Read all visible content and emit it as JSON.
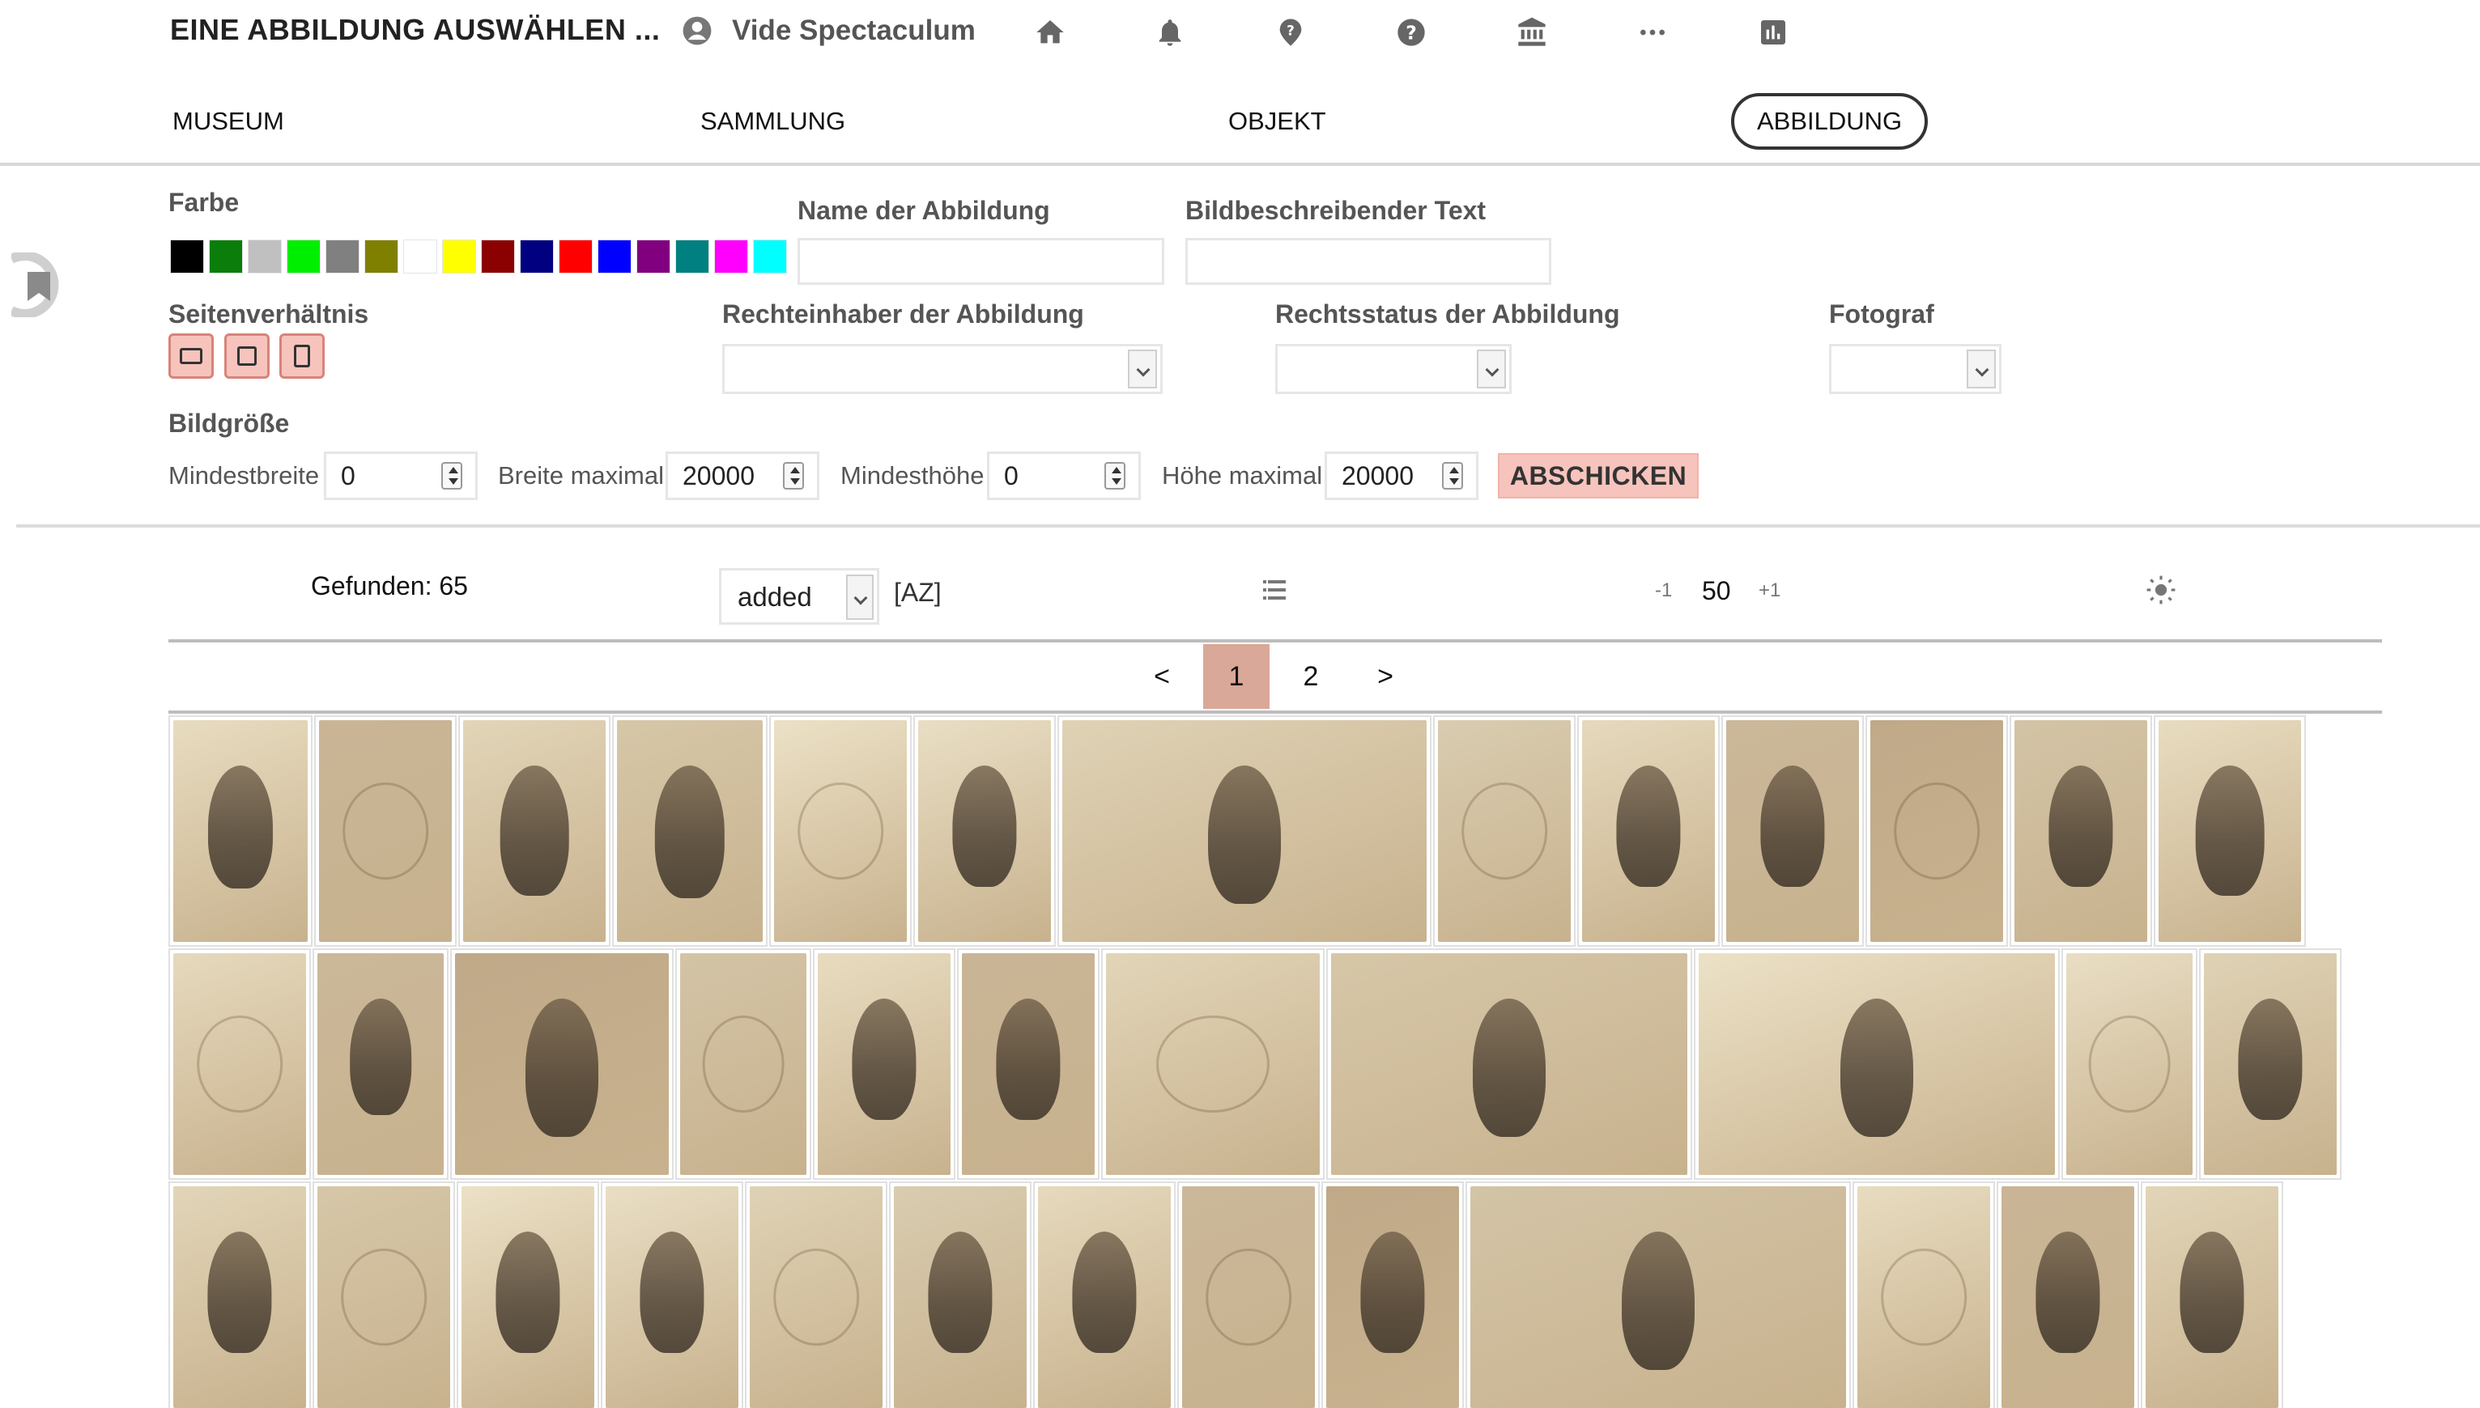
{
  "header": {
    "title": "EINE ABBILDUNG AUSWÄHLEN ...",
    "user_name": "Vide Spectaculum",
    "icons": [
      "home-icon",
      "bell-icon",
      "help-icon",
      "help-filled-icon",
      "museum-icon",
      "more-icon",
      "chart-icon"
    ]
  },
  "tabs": [
    {
      "label": "MUSEUM"
    },
    {
      "label": "SAMMLUNG"
    },
    {
      "label": "OBJEKT"
    },
    {
      "label": "ABBILDUNG",
      "active": true
    }
  ],
  "filters": {
    "color_label": "Farbe",
    "colors": [
      "#000000",
      "#0a7d0a",
      "#c0c0c0",
      "#00ee00",
      "#808080",
      "#808000",
      "#ffffff",
      "#ffff00",
      "#8b0000",
      "#000080",
      "#ff0000",
      "#0000ff",
      "#800080",
      "#008080",
      "#ff00ff",
      "#00ffff"
    ],
    "name_label": "Name der Abbildung",
    "name_value": "",
    "description_label": "Bildbeschreibender Text",
    "description_value": "",
    "aspect_label": "Seitenverhältnis",
    "rights_holder_label": "Rechteinhaber der Abbildung",
    "rights_holder_value": "",
    "rights_status_label": "Rechtsstatus der Abbildung",
    "rights_status_value": "",
    "photographer_label": "Fotograf",
    "photographer_value": "",
    "size_label": "Bildgröße",
    "min_width_label": "Mindestbreite",
    "min_width_value": "0",
    "max_width_label": "Breite maximal",
    "max_width_value": "20000",
    "min_height_label": "Mindesthöhe",
    "min_height_value": "0",
    "max_height_label": "Höhe maximal",
    "max_height_value": "20000",
    "submit_label": "ABSCHICKEN"
  },
  "results": {
    "found_label": "Gefunden: 65",
    "sort_value": "added",
    "sort_order_label": "[AZ]",
    "per_page_minus": "-1",
    "per_page": "50",
    "per_page_plus": "+1"
  },
  "pagination": {
    "prev": "<",
    "pages": [
      "1",
      "2"
    ],
    "current": "1",
    "next": ">"
  },
  "gallery": {
    "count_shown": 46
  }
}
